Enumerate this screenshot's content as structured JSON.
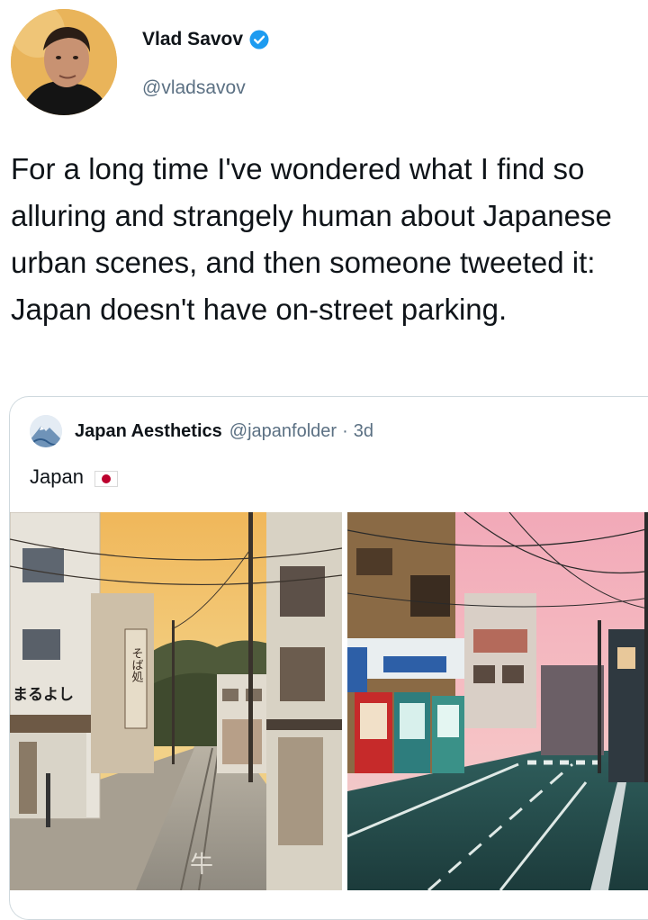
{
  "tweet": {
    "display_name": "Vlad Savov",
    "handle": "@vladsavov",
    "text": "For a long time I've wondered what I find so alluring and strangely human about Japanese urban scenes, and then someone tweeted it: Japan doesn't have on-street parking."
  },
  "quoted": {
    "display_name": "Japan Aesthetics",
    "handle": "@japanfolder",
    "separator": "·",
    "time": "3d",
    "text": "Japan"
  },
  "photos": {
    "left_shop_sign": "まるよし",
    "left_vertical_sign": "そば処"
  },
  "icons": {
    "verified": "verified-badge-icon",
    "flag": "japan-flag-icon"
  },
  "colors": {
    "verified_blue": "#1d9bf0",
    "secondary_text": "#5b7083",
    "flag_red": "#bc002d"
  }
}
